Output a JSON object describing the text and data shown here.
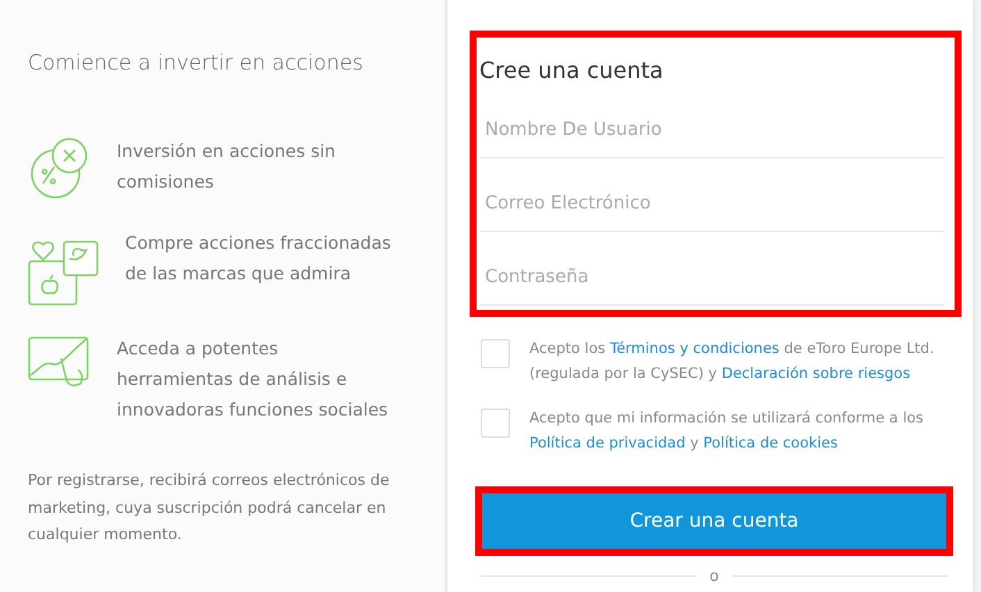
{
  "intro": {
    "title": "Comience a invertir en acciones",
    "features": [
      {
        "kind": "percent",
        "text": "Inversión en acciones sin comisiones"
      },
      {
        "kind": "brands",
        "text": "Compre acciones fraccionadas de las marcas que admira"
      },
      {
        "kind": "chart",
        "text": "Acceda a potentes herramientas de análisis e innovadoras funciones sociales"
      }
    ],
    "note": "Por registrarse, recibirá correos electrónicos de marketing, cuya suscripción podrá cancelar en cualquier momento."
  },
  "form": {
    "title": "Cree una cuenta",
    "highlighted": true,
    "fields": [
      {
        "placeholder": "Nombre De Usuario"
      },
      {
        "placeholder": "Correo Electrónico"
      },
      {
        "placeholder": "Contraseña"
      }
    ],
    "consents": [
      {
        "checked": false,
        "parts": [
          {
            "kind": "text",
            "text": "Acepto los "
          },
          {
            "kind": "link",
            "text": "Términos y condiciones"
          },
          {
            "kind": "text",
            "text": " de eToro Europe Ltd. (regulada por la CySEC) y "
          },
          {
            "kind": "link",
            "text": "Declaración sobre riesgos"
          }
        ]
      },
      {
        "checked": false,
        "parts": [
          {
            "kind": "text",
            "text": "Acepto que mi información se utilizará conforme a los "
          },
          {
            "kind": "link",
            "text": "Política de privacidad"
          },
          {
            "kind": "text",
            "text": " y "
          },
          {
            "kind": "link",
            "text": "Política de cookies"
          }
        ]
      }
    ],
    "submit": {
      "label": "Crear una cuenta",
      "highlighted": true
    },
    "separator": "o"
  }
}
